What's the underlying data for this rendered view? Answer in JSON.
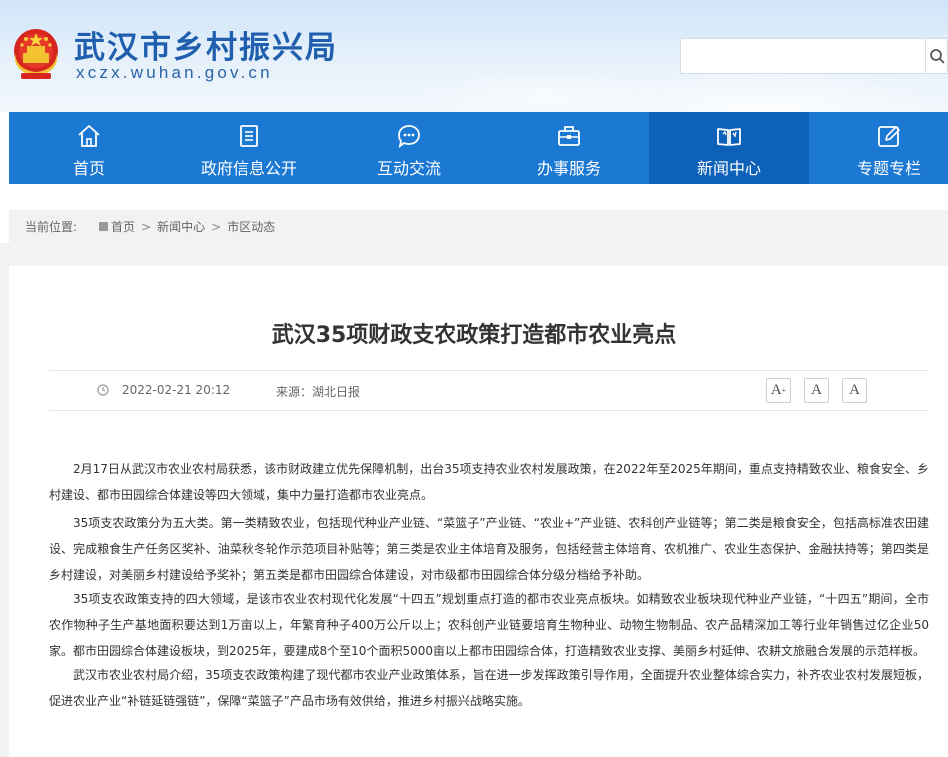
{
  "header": {
    "site_title": "武汉市乡村振兴局",
    "site_domain": "xczx.wuhan.gov.cn",
    "search_placeholder": ""
  },
  "nav": {
    "items": [
      {
        "label": "首页",
        "icon": "home-icon"
      },
      {
        "label": "政府信息公开",
        "icon": "document-icon"
      },
      {
        "label": "互动交流",
        "icon": "chat-icon"
      },
      {
        "label": "办事服务",
        "icon": "briefcase-icon"
      },
      {
        "label": "新闻中心",
        "icon": "book-icon",
        "active": true
      },
      {
        "label": "专题专栏",
        "icon": "edit-icon"
      }
    ]
  },
  "breadcrumb": {
    "prefix": "当前位置:",
    "home": "首页",
    "level1": "新闻中心",
    "level2": "市区动态",
    "separator": ">"
  },
  "article": {
    "title": "武汉35项财政支农政策打造都市农业亮点",
    "date": "2022-02-21 20:12",
    "source": "来源：湖北日报",
    "font_buttons": [
      "A+",
      "A",
      "A-"
    ],
    "paragraphs": [
      "2月17日从武汉市农业农村局获悉，该市财政建立优先保障机制，出台35项支持农业农村发展政策，在2022年至2025年期间，重点支持精致农业、粮食安全、乡村建设、都市田园综合体建设等四大领域，集中力量打造都市农业亮点。",
      "35项支农政策分为五大类。第一类精致农业，包括现代种业产业链、“菜篮子”产业链、“农业+”产业链、农科创产业链等；第二类是粮食安全，包括高标准农田建设、完成粮食生产任务区奖补、油菜秋冬轮作示范项目补贴等；第三类是农业主体培育及服务，包括经营主体培育、农机推广、农业生态保护、金融扶持等；第四类是乡村建设，对美丽乡村建设给予奖补；第五类是都市田园综合体建设，对市级都市田园综合体分级分档给予补助。",
      "35项支农政策支持的四大领域，是该市农业农村现代化发展“十四五”规划重点打造的都市农业亮点板块。如精致农业板块现代种业产业链，“十四五”期间，全市农作物种子生产基地面积要达到1万亩以上，年繁育种子400万公斤以上；农科创产业链要培育生物种业、动物生物制品、农产品精深加工等行业年销售过亿企业50家。都市田园综合体建设板块，到2025年，要建成8个至10个面积5000亩以上都市田园综合体，打造精致农业支撑、美丽乡村延伸、农耕文旅融合发展的示范样板。",
      "武汉市农业农村局介绍，35项支农政策构建了现代都市农业产业政策体系，旨在进一步发挥政策引导作用，全面提升农业整体综合实力，补齐农业农村发展短板，促进农业产业“补链延链强链”，保障“菜篮子”产品市场有效供给，推进乡村振兴战略实施。"
    ]
  },
  "colors": {
    "nav_bg": "#1b78d3",
    "nav_active": "#0e61b8",
    "title_blue": "#1f5fae"
  }
}
